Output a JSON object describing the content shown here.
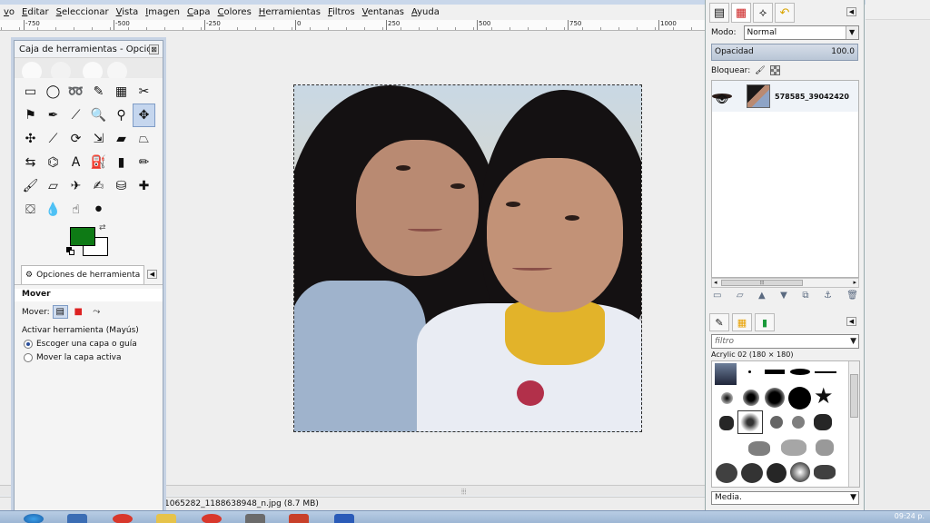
{
  "menu": [
    "vo",
    "Editar",
    "Seleccionar",
    "Vista",
    "Imagen",
    "Capa",
    "Colores",
    "Herramientas",
    "Filtros",
    "Ventanas",
    "Ayuda"
  ],
  "ruler_labels": [
    "-750",
    "-500",
    "-250",
    "0",
    "250",
    "500",
    "750",
    "1000"
  ],
  "toolbox": {
    "title": "Caja de herramientas - Opcion...",
    "close": "⊠",
    "tools": [
      {
        "name": "rect-select-icon",
        "g": "▭"
      },
      {
        "name": "ellipse-select-icon",
        "g": "◯"
      },
      {
        "name": "free-select-icon",
        "g": "➿"
      },
      {
        "name": "fuzzy-select-icon",
        "g": "✎"
      },
      {
        "name": "color-select-icon",
        "g": "▦"
      },
      {
        "name": "scissors-icon",
        "g": "✂"
      },
      {
        "name": "foreground-select-icon",
        "g": "⚑"
      },
      {
        "name": "paths-icon",
        "g": "✒"
      },
      {
        "name": "color-picker-icon",
        "g": "⟋"
      },
      {
        "name": "zoom-icon",
        "g": "🔍"
      },
      {
        "name": "measure-icon",
        "g": "⚲"
      },
      {
        "name": "move-icon",
        "g": "✥"
      },
      {
        "name": "align-icon",
        "g": "✣"
      },
      {
        "name": "crop-icon",
        "g": "⟋"
      },
      {
        "name": "rotate-icon",
        "g": "⟳"
      },
      {
        "name": "scale-icon",
        "g": "⇲"
      },
      {
        "name": "shear-icon",
        "g": "▰"
      },
      {
        "name": "perspective-icon",
        "g": "⏢"
      },
      {
        "name": "flip-icon",
        "g": "⇆"
      },
      {
        "name": "cage-icon",
        "g": "⌬"
      },
      {
        "name": "text-icon",
        "g": "A"
      },
      {
        "name": "bucket-fill-icon",
        "g": "⛽"
      },
      {
        "name": "blend-icon",
        "g": "▮"
      },
      {
        "name": "pencil-icon",
        "g": "✏"
      },
      {
        "name": "paintbrush-icon",
        "g": "🖌"
      },
      {
        "name": "eraser-icon",
        "g": "▱"
      },
      {
        "name": "airbrush-icon",
        "g": "✈"
      },
      {
        "name": "ink-icon",
        "g": "✍"
      },
      {
        "name": "clone-icon",
        "g": "⛁"
      },
      {
        "name": "heal-icon",
        "g": "✚"
      },
      {
        "name": "perspective-clone-icon",
        "g": "⛋"
      },
      {
        "name": "blur-icon",
        "g": "💧"
      },
      {
        "name": "smudge-icon",
        "g": "☝"
      },
      {
        "name": "dodge-burn-icon",
        "g": "⚫"
      }
    ],
    "active_tool": 11,
    "fg_color": "#0e7a15",
    "bg_color": "#ffffff",
    "tab_label": "Opciones de herramienta",
    "options_heading": "Mover",
    "mover_label": "Mover:",
    "activar_label": "Activar herramienta  (Mayús)",
    "radio": [
      "Escoger una capa o guía",
      "Mover la capa activa"
    ]
  },
  "layers": {
    "mode_label": "Modo:",
    "mode_value": "Normal",
    "opacity_label": "Opacidad",
    "opacity_value": "100.0",
    "lock_label": "Bloquear:",
    "layer_name": "578585_39042420"
  },
  "brushes": {
    "filter_placeholder": "filtro",
    "brush_name": "Acrylic 02 (180 × 180)",
    "media_label": "Media."
  },
  "status": {
    "filename": "1065282_1188638948_n.jpg (8.7 MB)"
  },
  "clock": "09:24 p.",
  "colors": {
    "accent": "#c5d6ee",
    "taskbar": "#9db6d4",
    "selection_border": "#2c2c2c"
  }
}
